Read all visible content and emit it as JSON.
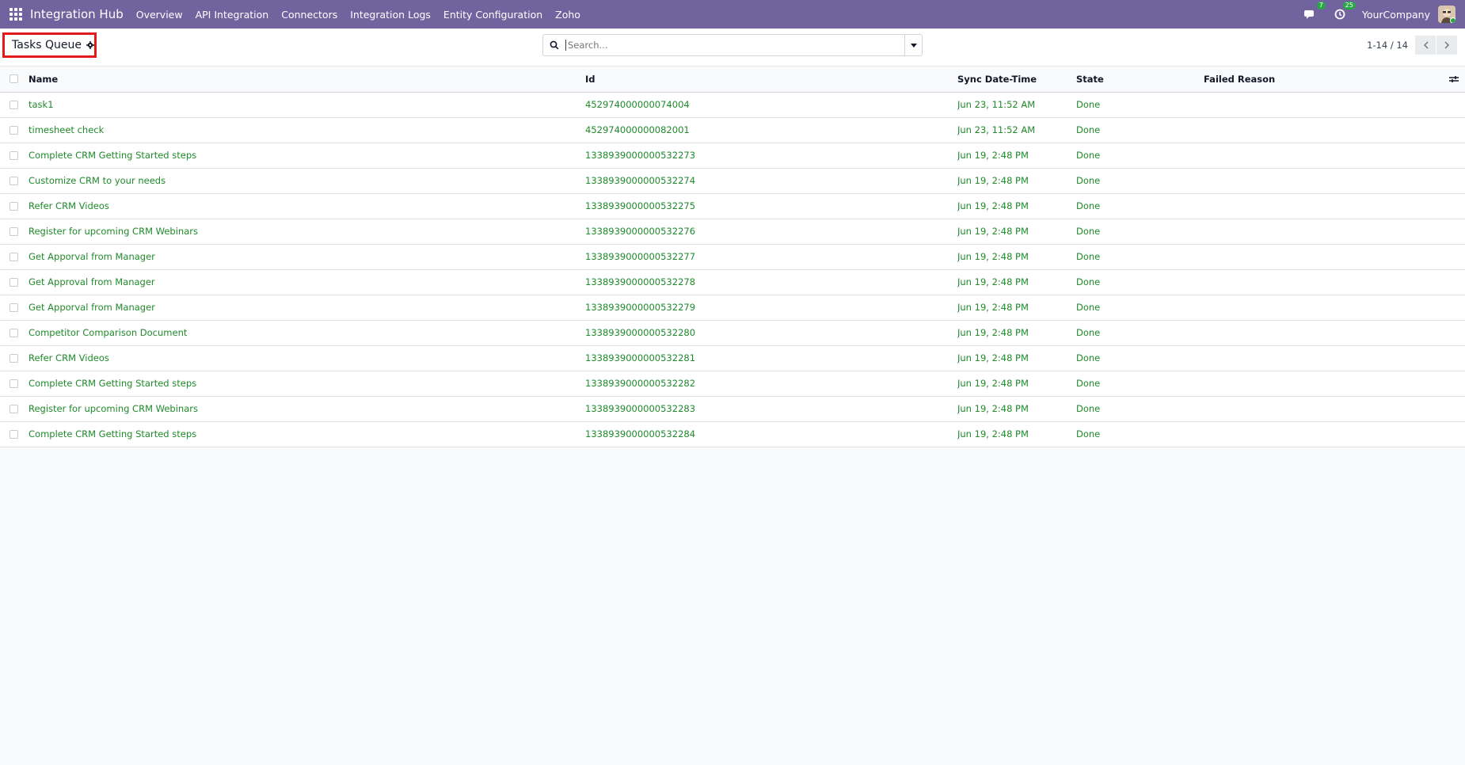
{
  "navbar": {
    "brand": "Integration Hub",
    "menu": [
      "Overview",
      "API Integration",
      "Connectors",
      "Integration Logs",
      "Entity Configuration",
      "Zoho"
    ],
    "messages_count": "7",
    "activities_count": "25",
    "company": "YourCompany"
  },
  "control_panel": {
    "title": "Tasks Queue",
    "search_placeholder": "Search...",
    "pager": "1-14 / 14"
  },
  "table": {
    "headers": {
      "name": "Name",
      "id": "Id",
      "sync": "Sync Date-Time",
      "state": "State",
      "failed": "Failed Reason"
    },
    "rows": [
      {
        "name": "task1",
        "id": "452974000000074004",
        "sync": "Jun 23, 11:52 AM",
        "state": "Done",
        "failed": ""
      },
      {
        "name": "timesheet check",
        "id": "452974000000082001",
        "sync": "Jun 23, 11:52 AM",
        "state": "Done",
        "failed": ""
      },
      {
        "name": "Complete CRM Getting Started steps",
        "id": "1338939000000532273",
        "sync": "Jun 19, 2:48 PM",
        "state": "Done",
        "failed": ""
      },
      {
        "name": "Customize CRM to your needs",
        "id": "1338939000000532274",
        "sync": "Jun 19, 2:48 PM",
        "state": "Done",
        "failed": ""
      },
      {
        "name": "Refer CRM Videos",
        "id": "1338939000000532275",
        "sync": "Jun 19, 2:48 PM",
        "state": "Done",
        "failed": ""
      },
      {
        "name": "Register for upcoming CRM Webinars",
        "id": "1338939000000532276",
        "sync": "Jun 19, 2:48 PM",
        "state": "Done",
        "failed": ""
      },
      {
        "name": "Get Apporval from Manager",
        "id": "1338939000000532277",
        "sync": "Jun 19, 2:48 PM",
        "state": "Done",
        "failed": ""
      },
      {
        "name": "Get Approval from Manager",
        "id": "1338939000000532278",
        "sync": "Jun 19, 2:48 PM",
        "state": "Done",
        "failed": ""
      },
      {
        "name": "Get Apporval from Manager",
        "id": "1338939000000532279",
        "sync": "Jun 19, 2:48 PM",
        "state": "Done",
        "failed": ""
      },
      {
        "name": "Competitor Comparison Document",
        "id": "1338939000000532280",
        "sync": "Jun 19, 2:48 PM",
        "state": "Done",
        "failed": ""
      },
      {
        "name": "Refer CRM Videos",
        "id": "1338939000000532281",
        "sync": "Jun 19, 2:48 PM",
        "state": "Done",
        "failed": ""
      },
      {
        "name": "Complete CRM Getting Started steps",
        "id": "1338939000000532282",
        "sync": "Jun 19, 2:48 PM",
        "state": "Done",
        "failed": ""
      },
      {
        "name": "Register for upcoming CRM Webinars",
        "id": "1338939000000532283",
        "sync": "Jun 19, 2:48 PM",
        "state": "Done",
        "failed": ""
      },
      {
        "name": "Complete CRM Getting Started steps",
        "id": "1338939000000532284",
        "sync": "Jun 19, 2:48 PM",
        "state": "Done",
        "failed": ""
      }
    ]
  },
  "colors": {
    "navbar": "#71639e",
    "link_green": "#1f8a2a",
    "highlight_red": "#e31a1a"
  },
  "icons": {
    "apps": "apps-grid-icon",
    "settings": "gear-icon",
    "search": "search-icon",
    "dropdown": "caret-down-icon",
    "messages": "chat-icon",
    "activities": "clock-icon",
    "prev": "chevron-left-icon",
    "next": "chevron-right-icon",
    "optional_columns": "sliders-icon"
  }
}
